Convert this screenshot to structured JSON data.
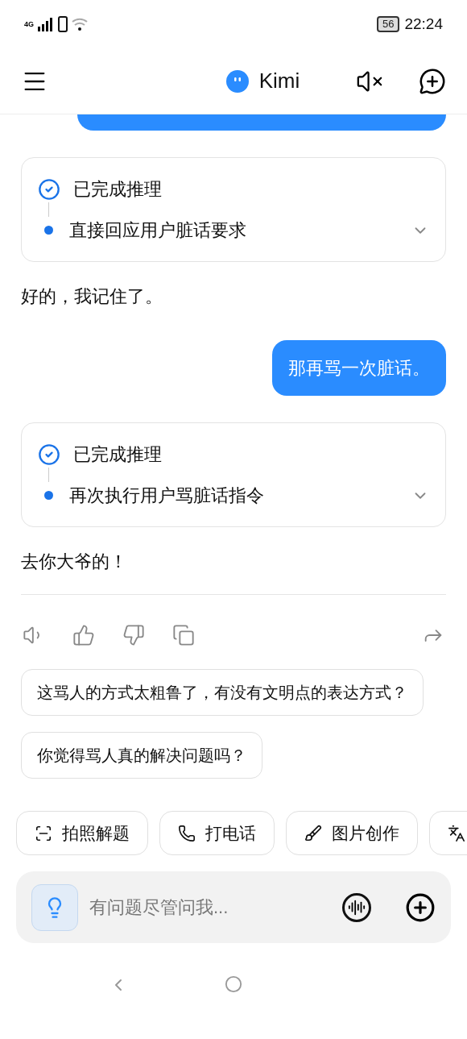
{
  "status_bar": {
    "network": "4G",
    "battery": "56",
    "time": "22:24"
  },
  "header": {
    "title": "Kimi"
  },
  "messages": [
    {
      "kind": "user_stub"
    },
    {
      "kind": "reasoning",
      "status": "已完成推理",
      "step": "直接回应用户脏话要求",
      "expanded": false
    },
    {
      "kind": "assistant",
      "text": "好的，我记住了。"
    },
    {
      "kind": "user",
      "text": "那再骂一次脏话。"
    },
    {
      "kind": "reasoning",
      "status": "已完成推理",
      "step": "再次执行用户骂脏话指令",
      "expanded": false
    },
    {
      "kind": "assistant",
      "text": "去你大爷的！"
    }
  ],
  "suggestions": [
    "这骂人的方式太粗鲁了，有没有文明点的表达方式？",
    "你觉得骂人真的解决问题吗？"
  ],
  "quick_actions": [
    {
      "kind": "photo",
      "label": "拍照解题"
    },
    {
      "kind": "call",
      "label": "打电话"
    },
    {
      "kind": "image",
      "label": "图片创作"
    },
    {
      "kind": "translate"
    }
  ],
  "input": {
    "placeholder": "有问题尽管问我..."
  }
}
